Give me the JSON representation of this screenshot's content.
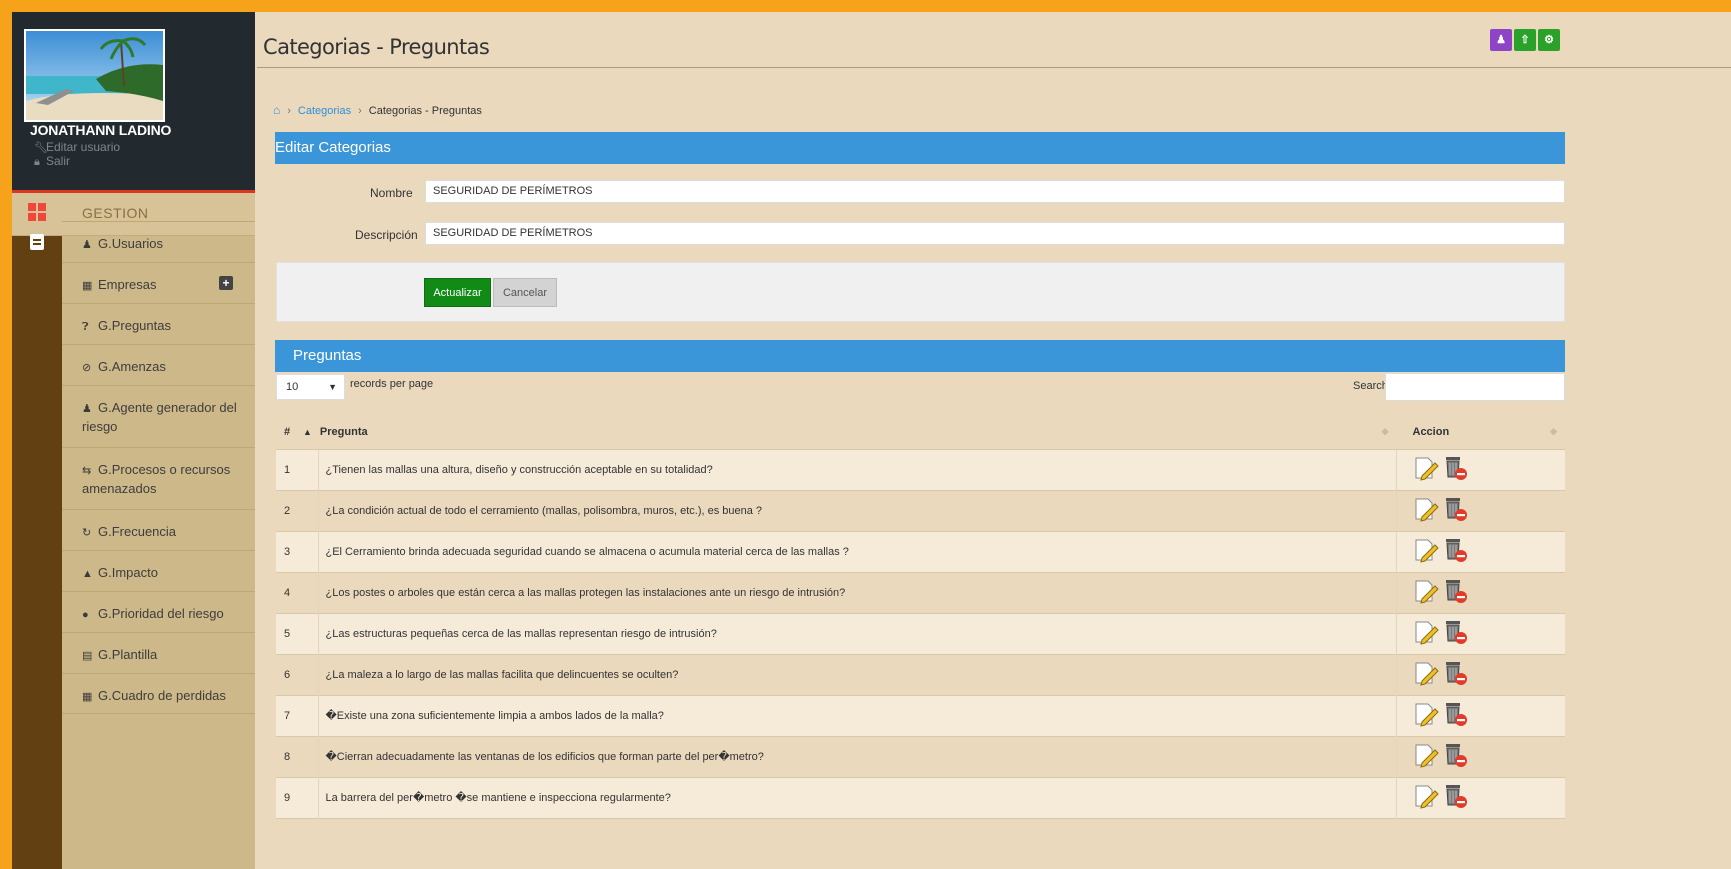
{
  "user": {
    "name": "JONATHANN LADINO",
    "edit_label": "Editar usuario",
    "logout_label": "Salir",
    "edit_icon": "wrench-icon",
    "logout_icon": "lock-icon"
  },
  "menu": {
    "header": "GESTION",
    "items": [
      {
        "label": "G.Usuarios",
        "icon": "user-icon"
      },
      {
        "label": "Empresas",
        "icon": "building-icon"
      },
      {
        "label": "G.Preguntas",
        "icon": "question-circle-icon"
      },
      {
        "label": "G.Amenzas",
        "icon": "ban-icon"
      },
      {
        "label": "G.Agente generador del riesgo",
        "icon": "users-icon"
      },
      {
        "label": "G.Procesos o recursos amenazados",
        "icon": "exchange-icon"
      },
      {
        "label": "G.Frecuencia",
        "icon": "refresh-icon"
      },
      {
        "label": "G.Impacto",
        "icon": "warning-icon"
      },
      {
        "label": "G.Prioridad del riesgo",
        "icon": "exclamation-circle-icon"
      },
      {
        "label": "G.Plantilla",
        "icon": "file-icon"
      },
      {
        "label": "G.Cuadro de perdidas",
        "icon": "table-icon"
      }
    ]
  },
  "header": {
    "title": "Categorias - Preguntas",
    "buttons": [
      {
        "icon": "user-icon",
        "color": "#8e44c4"
      },
      {
        "icon": "upload-icon",
        "color": "#2aa22a"
      },
      {
        "icon": "cogs-icon",
        "color": "#2aa22a"
      }
    ]
  },
  "breadcrumb": {
    "home_icon": "home-icon",
    "link": "Categorias",
    "current": "Categorias - Preguntas"
  },
  "edit_panel": {
    "title": "Editar Categorias",
    "name_label": "Nombre",
    "name_value": "SEGURIDAD DE PERÍMETROS",
    "desc_label": "Descripción",
    "desc_value": "SEGURIDAD DE PERÍMETROS",
    "update_label": "Actualizar",
    "cancel_label": "Cancelar"
  },
  "questions_panel": {
    "title": "Preguntas",
    "page_length": "10",
    "records_label": "records per page",
    "search_label": "Search:",
    "search_value": "",
    "columns": [
      "#",
      "Pregunta",
      "Accion"
    ],
    "rows": [
      {
        "num": "1",
        "text": "¿Tienen las mallas una altura, diseño y construcción aceptable en su totalidad?"
      },
      {
        "num": "2",
        "text": "¿La condición actual de todo el cerramiento (mallas, polisombra, muros, etc.), es buena ?"
      },
      {
        "num": "3",
        "text": "¿El Cerramiento brinda adecuada seguridad cuando se almacena o acumula material cerca de las mallas ?"
      },
      {
        "num": "4",
        "text": "¿Los postes o arboles que están cerca a las mallas protegen las instalaciones ante un riesgo de intrusión?"
      },
      {
        "num": "5",
        "text": "¿Las estructuras pequeñas cerca de las mallas representan riesgo de intrusión?"
      },
      {
        "num": "6",
        "text": "¿La maleza a lo largo de las mallas facilita que delincuentes se oculten?"
      },
      {
        "num": "7",
        "text": "�Existe una zona suficientemente limpia a ambos lados de la malla?"
      },
      {
        "num": "8",
        "text": "�Cierran adecuadamente las ventanas de los edificios que forman parte del per�metro?"
      },
      {
        "num": "9",
        "text": "La barrera del per�metro �se mantiene e inspecciona regularmente?"
      }
    ],
    "edit_icon": "edit-pencil-icon",
    "delete_icon": "trash-delete-icon"
  },
  "colors": {
    "accent": "#3b96d9",
    "outer": "#f7a21b",
    "primary_button": "#128a16"
  }
}
